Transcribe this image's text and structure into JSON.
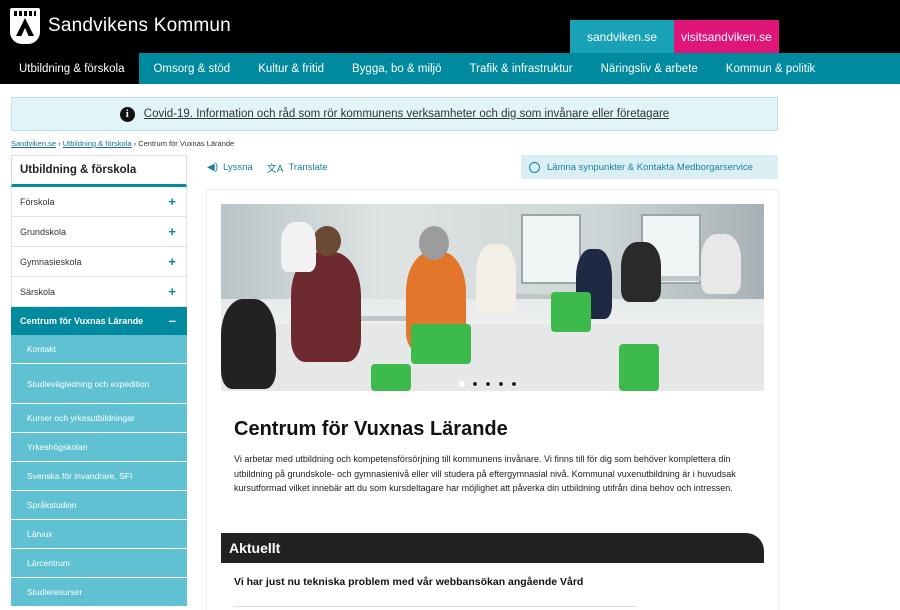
{
  "header": {
    "logo_text": "Sandvikens Kommun",
    "site_tabs": [
      "sandviken.se",
      "visitsandviken.se"
    ]
  },
  "nav": {
    "items": [
      "Utbildning & förskola",
      "Omsorg & stöd",
      "Kultur & fritid",
      "Bygga, bo & miljö",
      "Trafik & infrastruktur",
      "Näringsliv & arbete",
      "Kommun & politik"
    ],
    "active_index": 0
  },
  "banner": {
    "text": "Covid-19. Information och råd som rör kommunens verksamheter och dig som invånare eller företagare"
  },
  "breadcrumb": {
    "links": [
      "Sandviken.se",
      "Utbildning & förskola"
    ],
    "current": "Centrum för Vuxnas Lärande",
    "separator": "›"
  },
  "sidebar": {
    "heading": "Utbildning & förskola",
    "items": [
      "Förskola",
      "Grundskola",
      "Gymnasieskola",
      "Särskola"
    ],
    "plus_symbol": "+",
    "active_item": "Centrum för Vuxnas Lärande",
    "minus_symbol": "–",
    "sub_items": [
      "Kontakt",
      "Studievägledning och expedition",
      "Kurser och yrkesutbildningar",
      "Yrkeshögskolan",
      "Svenska för invandrare, SFI",
      "Språkstudion",
      "Lärvux",
      "Lärcentrum",
      "Studieresurser"
    ]
  },
  "tools": {
    "listen": "Lyssna",
    "translate": "Translate",
    "feedback": "Lämna synpunkter & Kontakta Medborgarservice"
  },
  "content": {
    "title": "Centrum för Vuxnas Lärande",
    "intro": "Vi arbetar med utbildning och kompetensförsörjning till kommunens invånare. Vi finns till för dig som behöver komplettera din utbildning på grundskole- och gymnasienivå eller vill studera på eftergymnasial nivå. Kommunal vuxenutbildning är i huvudsak kursutformad vilket innebär att du som kursdeltagare har möjlighet att påverka din utbildning utifrån dina behov och intressen.",
    "slider_count": 5,
    "slider_active": 0,
    "news_heading": "Aktuellt",
    "news_items": [
      "Vi har just nu tekniska problem med vår webbansökan angående Vård"
    ]
  },
  "colors": {
    "teal": "#008aa0",
    "light_teal": "#5fc1d2",
    "pink": "#e0157a",
    "black": "#000000"
  },
  "icons": [
    "crest-logo",
    "info-icon",
    "speaker-icon",
    "translate-icon",
    "chat-bubble-icon",
    "plus-icon",
    "minus-icon"
  ]
}
